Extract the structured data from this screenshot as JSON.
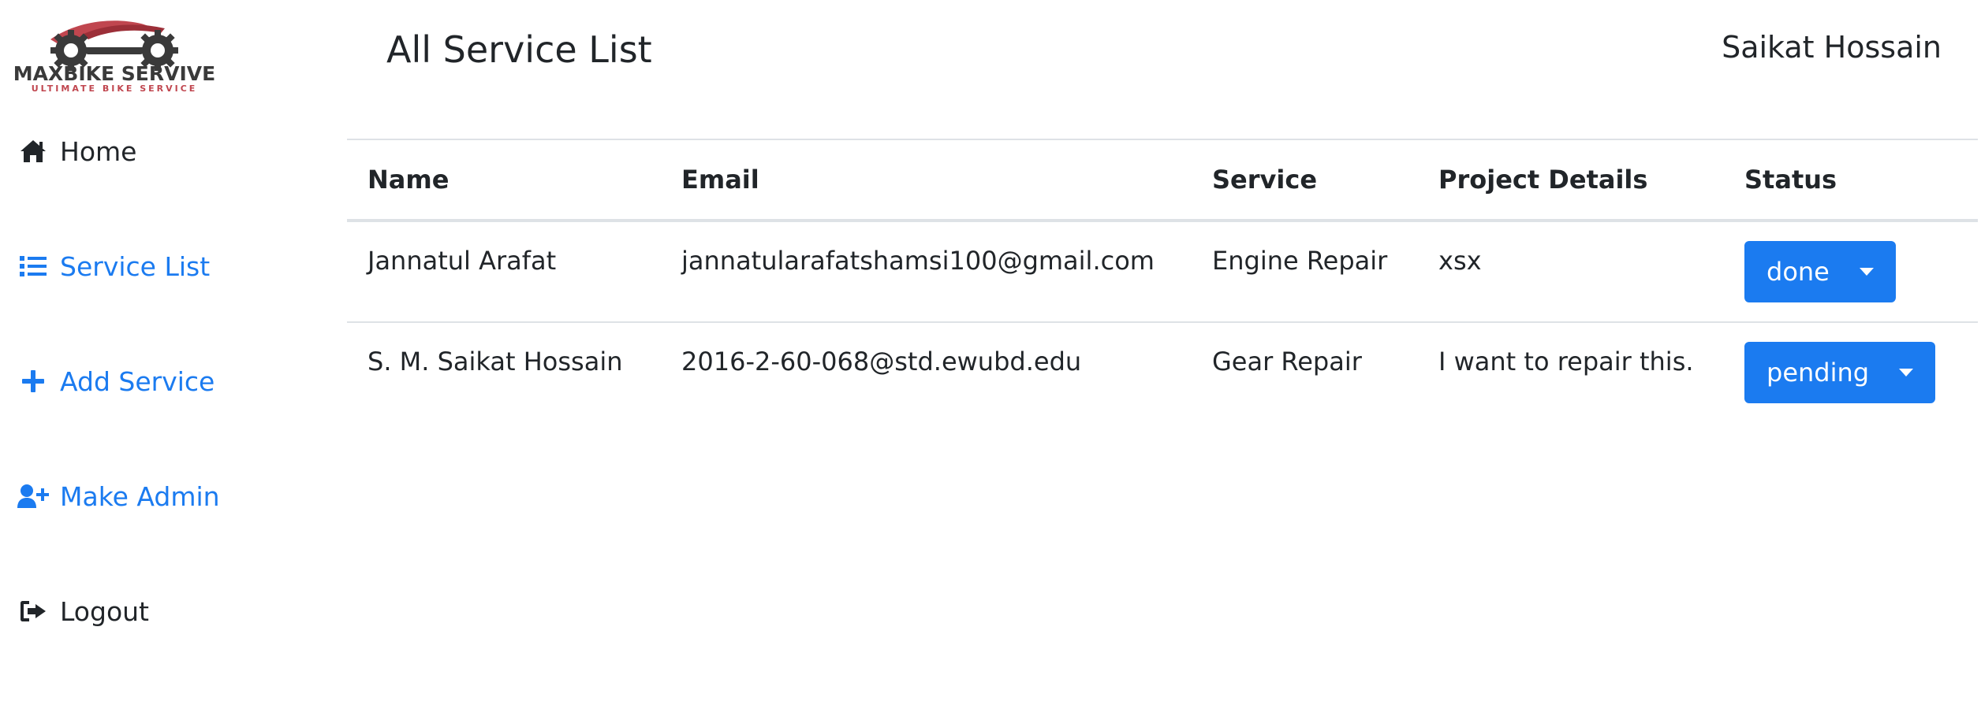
{
  "brand": {
    "name": "MAXBIKE SERVIVE",
    "tagline": "ULTIMATE BIKE SERVICE",
    "accent_color": "#c0464f",
    "gear_color": "#3a3a3a"
  },
  "sidebar": {
    "items": [
      {
        "label": "Home",
        "icon": "home-icon",
        "color": "#212529"
      },
      {
        "label": "Service List",
        "icon": "list-icon",
        "color": "#1b7bf0"
      },
      {
        "label": "Add Service",
        "icon": "plus-icon",
        "color": "#1b7bf0"
      },
      {
        "label": "Make Admin",
        "icon": "user-plus-icon",
        "color": "#1b7bf0"
      },
      {
        "label": "Logout",
        "icon": "sign-out-icon",
        "color": "#212529"
      }
    ]
  },
  "header": {
    "title": "All Service List",
    "user_name": "Saikat Hossain"
  },
  "table": {
    "columns": [
      "Name",
      "Email",
      "Service",
      "Project Details",
      "Status"
    ],
    "rows": [
      {
        "name": "Jannatul Arafat",
        "email": "jannatularafatshamsi100@gmail.com",
        "service": "Engine Repair",
        "details": "xsx",
        "status": "done"
      },
      {
        "name": "S. M. Saikat Hossain",
        "email": "2016-2-60-068@std.ewubd.edu",
        "service": "Gear Repair",
        "details": "I want to repair this.",
        "status": "pending"
      }
    ]
  },
  "colors": {
    "primary": "#1b7bf0",
    "text": "#212529",
    "border": "#dee2e6"
  }
}
